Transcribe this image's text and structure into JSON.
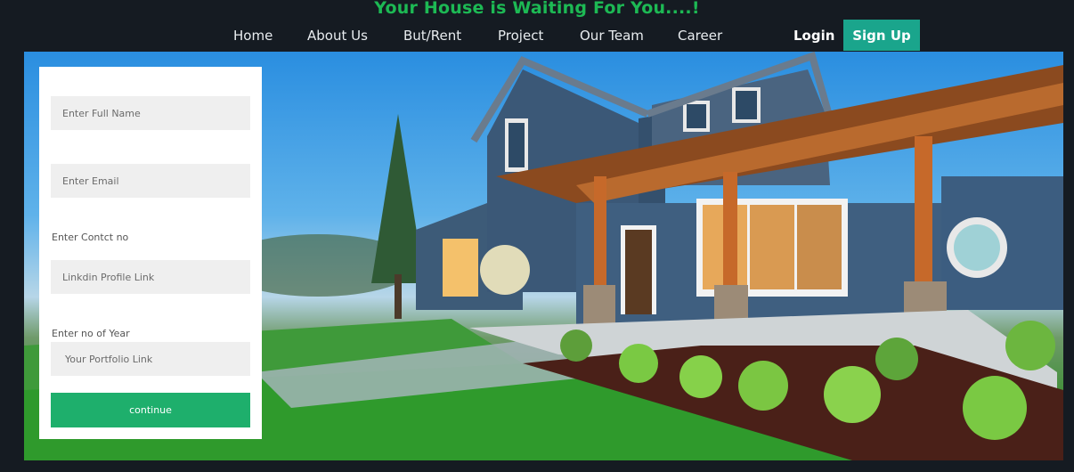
{
  "header": {
    "tagline": "Your House is Waiting For You....!",
    "nav": [
      "Home",
      "About Us",
      "But/Rent",
      "Project",
      "Our Team",
      "Career"
    ],
    "login_label": "Login",
    "signup_label": "Sign Up"
  },
  "form": {
    "full_name_placeholder": "Enter Full Name",
    "email_placeholder": "Enter Email",
    "contact_label": "Enter Contct no",
    "linkedin_placeholder": "Linkdin Profile Link",
    "years_label": "Enter no of Year",
    "portfolio_placeholder": "Your Portfolio Link",
    "continue_label": "continue"
  },
  "colors": {
    "accent_green": "#1db954",
    "signup_teal": "#1aa58c",
    "continue_green": "#1eaf6c",
    "page_bg": "#151b22"
  }
}
